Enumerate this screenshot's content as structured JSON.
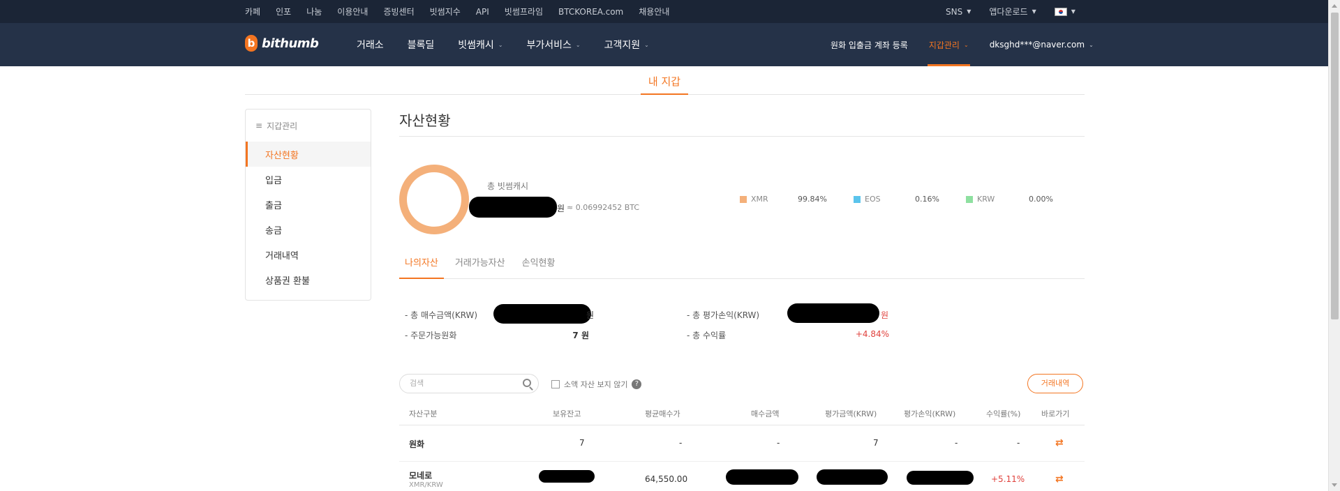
{
  "topbar": {
    "links": [
      "카페",
      "인포",
      "나눔",
      "이용안내",
      "증빙센터",
      "빗썸지수",
      "API",
      "빗썸프라임",
      "BTCKOREA.com",
      "채용안내"
    ],
    "sns": "SNS",
    "app_download": "앱다운로드"
  },
  "nav": {
    "logo_mark": "b",
    "logo_text": "bithumb",
    "menu": [
      "거래소",
      "블록딜",
      "빗썸캐시",
      "부가서비스",
      "고객지원"
    ],
    "account_register": "원화 입출금 계좌 등록",
    "wallet_manage": "지갑관리",
    "user_email": "dksghd***@naver.com"
  },
  "page_tab": "내 지갑",
  "sidebar": {
    "header": "지갑관리",
    "items": [
      "자산현황",
      "입금",
      "출금",
      "송금",
      "거래내역",
      "상품권 환불"
    ]
  },
  "assets": {
    "title": "자산현황",
    "total_label": "총 빗썸캐시",
    "total_unit": "원",
    "total_btc": "≈ 0.06992452 BTC",
    "legend": [
      {
        "name": "XMR",
        "pct": "99.84%",
        "color": "#f4b07a"
      },
      {
        "name": "EOS",
        "pct": "0.16%",
        "color": "#5bc4ec"
      },
      {
        "name": "KRW",
        "pct": "0.00%",
        "color": "#8ee0a0"
      }
    ],
    "donut_share": {
      "XMR": 99.84,
      "EOS": 0.16,
      "KRW": 0.0
    }
  },
  "subtabs": [
    "나의자산",
    "거래가능자산",
    "손익현황"
  ],
  "summary": {
    "total_buy_label": "- 총 매수금액(KRW)",
    "total_buy_unit": "원",
    "orderable_label": "- 주문가능원화",
    "orderable_value": "7 원",
    "total_eval_label": "- 총 평가손익(KRW)",
    "total_eval_unit": "원",
    "total_return_label": "- 총 수익률",
    "total_return_value": "+4.84%"
  },
  "filter": {
    "search_placeholder": "검색",
    "hide_small": "소액 자산 보지 않기",
    "help": "?",
    "history_button": "거래내역"
  },
  "table": {
    "headers": [
      "자산구분",
      "보유잔고",
      "평균매수가",
      "매수금액",
      "평가금액(KRW)",
      "평가손익(KRW)",
      "수익률(%)",
      "바로가기"
    ],
    "rows": [
      {
        "name": "원화",
        "sub": "",
        "balance": "7",
        "avg": "-",
        "buy": "-",
        "eval": "7",
        "pnl": "-",
        "rate": "-"
      },
      {
        "name": "모네로",
        "sub": "XMR/KRW",
        "balance": "",
        "avg": "64,550.00",
        "buy": "",
        "eval": "",
        "pnl": "",
        "rate": "+5.11%"
      }
    ],
    "swap_icon": "⇄"
  }
}
